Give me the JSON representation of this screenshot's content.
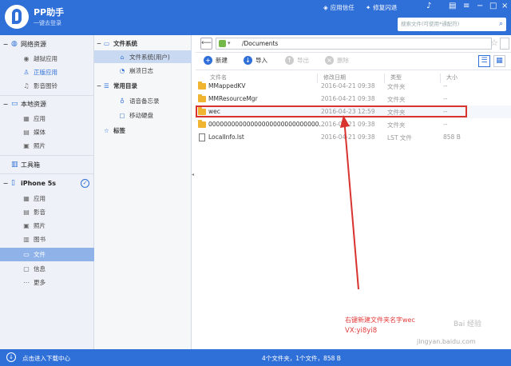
{
  "app": {
    "title": "PP助手",
    "subtitle": "一键去登录",
    "menu_trust": "应用信任",
    "menu_flash": "修复闪退"
  },
  "search": {
    "placeholder": "搜索文件(可使用*通配符)"
  },
  "sidebar": {
    "sections": [
      {
        "label": "网络资源",
        "items": [
          {
            "label": "越狱应用"
          },
          {
            "label": "正版应用"
          },
          {
            "label": "影音图铃"
          }
        ]
      },
      {
        "label": "本地资源",
        "items": [
          {
            "label": "应用"
          },
          {
            "label": "媒体"
          },
          {
            "label": "照片"
          }
        ]
      },
      {
        "label": "工具箱",
        "items": []
      },
      {
        "label": "iPhone 5s",
        "items": [
          {
            "label": "应用"
          },
          {
            "label": "影音"
          },
          {
            "label": "照片"
          },
          {
            "label": "图书"
          },
          {
            "label": "文件"
          },
          {
            "label": "信息"
          },
          {
            "label": "更多"
          }
        ]
      }
    ]
  },
  "tree": {
    "file_system": "文件系统",
    "file_system_user": "文件系统(用户)",
    "crash_log": "崩溃日志",
    "common_dirs": "常用目录",
    "voice_memo": "语音备忘录",
    "mobile_disk": "移动硬盘",
    "bookmarks": "标签"
  },
  "path": {
    "value": "/Documents"
  },
  "toolbar": {
    "new": "新建",
    "import": "导入",
    "export": "导出",
    "delete": "删除"
  },
  "columns": {
    "name": "文件名",
    "date": "修改日期",
    "type": "类型",
    "size": "大小"
  },
  "files": [
    {
      "name": "MMappedKV",
      "date": "2016-04-21 09:38",
      "type": "文件夹",
      "size": "--"
    },
    {
      "name": "MMResourceMgr",
      "date": "2016-04-21 09:38",
      "type": "文件夹",
      "size": "--"
    },
    {
      "name": "wec",
      "date": "2016-04-23 12:59",
      "type": "文件夹",
      "size": "--"
    },
    {
      "name": "00000000000000000000000000000...",
      "date": "2016-04-21 09:38",
      "type": "文件夹",
      "size": "--"
    },
    {
      "name": "LocalInfo.lst",
      "date": "2016-04-21 09:38",
      "type": "LST 文件",
      "size": "858 B"
    }
  ],
  "annotation": {
    "line1": "右键新建文件夹名字wec",
    "line2": "VX:yi8yi8"
  },
  "watermark": {
    "text": "Bai 经验",
    "url": "jingyan.baidu.com"
  },
  "bottom": {
    "download_center": "点击进入下载中心",
    "status": "4个文件夹，1个文件，858 B"
  },
  "colors": {
    "brand": "#2f6fd8",
    "highlight": "#d9332f",
    "folder": "#f0b430"
  }
}
